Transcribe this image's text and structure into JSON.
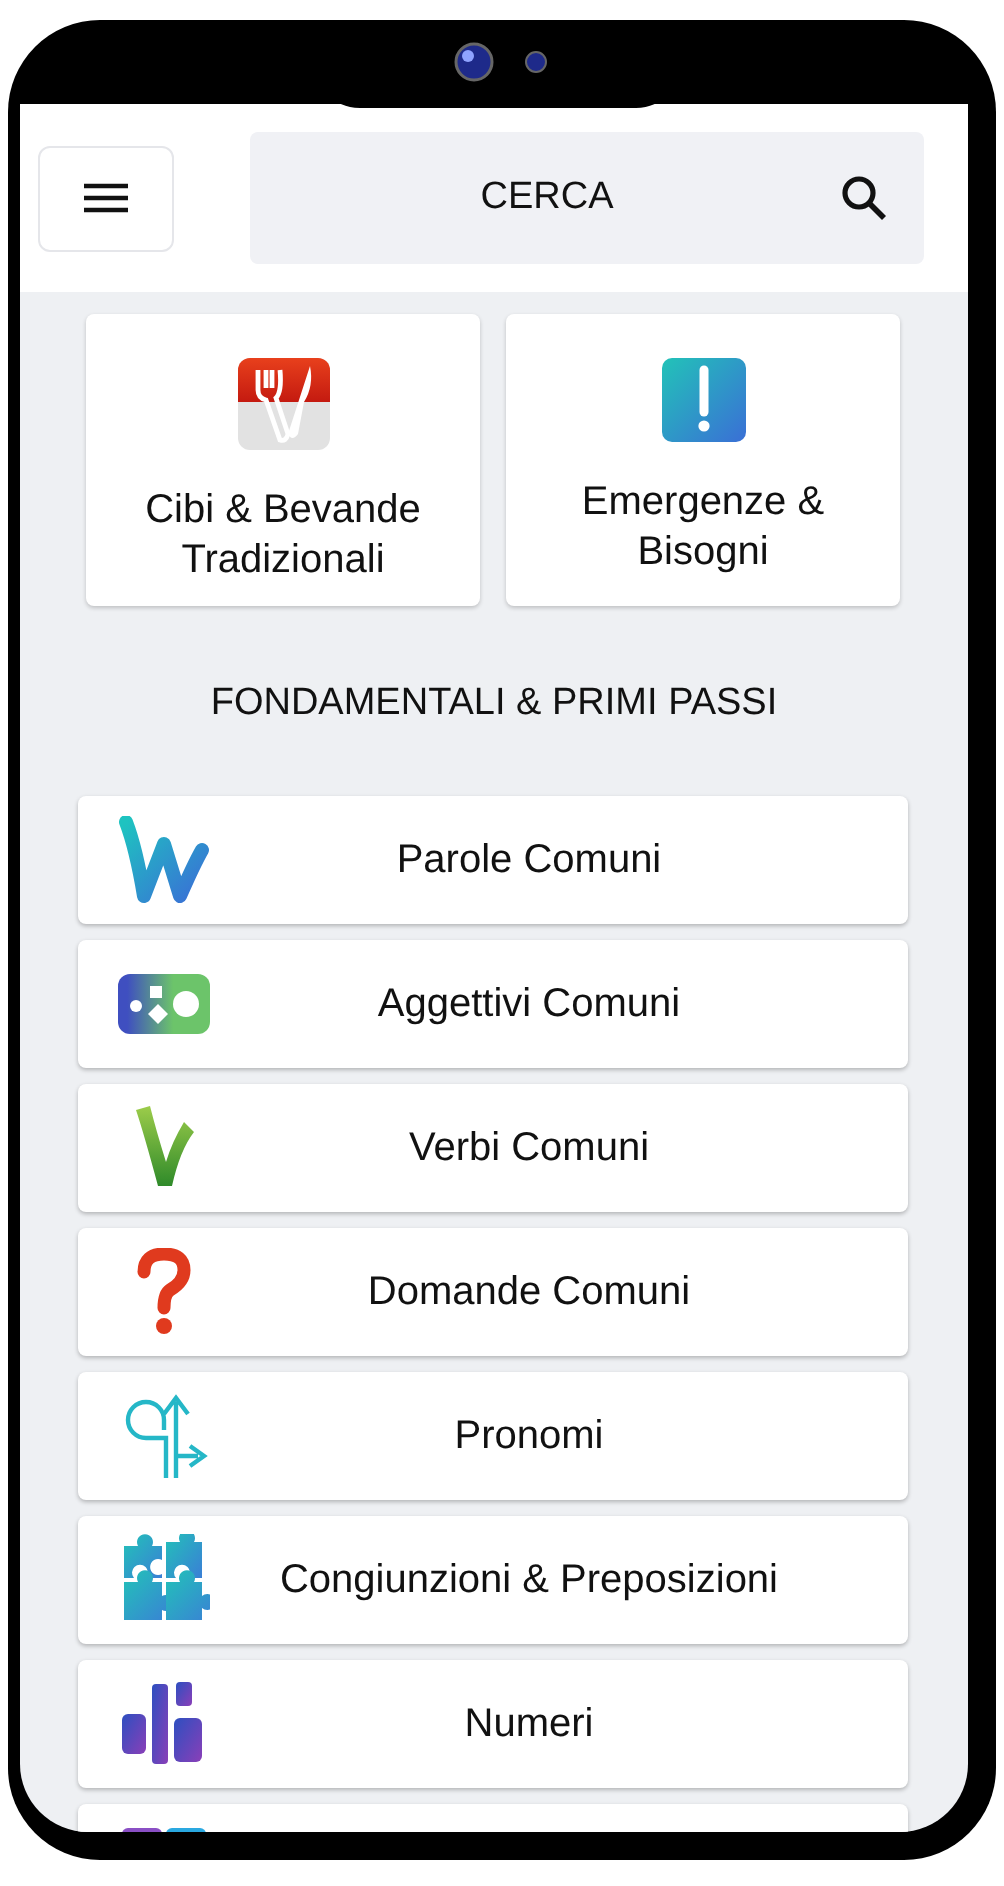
{
  "search": {
    "placeholder": "CERCA"
  },
  "featured": [
    {
      "label": "Cibi & Bevande Tradizionali",
      "kind": "food"
    },
    {
      "label": "Emergenze & Bisogni",
      "kind": "alert"
    }
  ],
  "section_title": "FONDAMENTALI & PRIMI PASSI",
  "categories": [
    {
      "label": "Parole Comuni",
      "kind": "words"
    },
    {
      "label": "Aggettivi Comuni",
      "kind": "adjectives"
    },
    {
      "label": "Verbi Comuni",
      "kind": "verbs"
    },
    {
      "label": "Domande Comuni",
      "kind": "questions"
    },
    {
      "label": "Pronomi",
      "kind": "pronouns"
    },
    {
      "label": "Congiunzioni & Preposizioni",
      "kind": "puzzle"
    },
    {
      "label": "Numeri",
      "kind": "numbers"
    },
    {
      "kind": "tiles"
    }
  ]
}
